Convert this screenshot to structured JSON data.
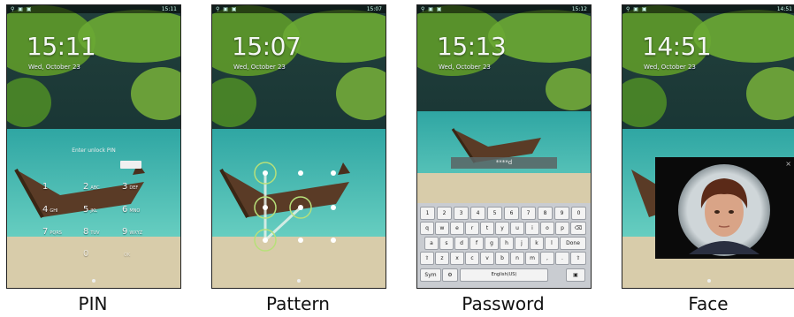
{
  "panels": [
    {
      "caption": "PIN",
      "time": "15:11",
      "date": "Wed, October 23"
    },
    {
      "caption": "Pattern",
      "time": "15:07",
      "date": "Wed, October 23"
    },
    {
      "caption": "Password",
      "time": "15:13",
      "date": "Wed, October 23"
    },
    {
      "caption": "Face",
      "time": "14:51",
      "date": "Wed, October 23"
    }
  ],
  "status": {
    "left": "⚲ ▣ ▣",
    "right1": "15:11",
    "right2": "15:07",
    "right3": "15:12",
    "right4": "14:51"
  },
  "pin": {
    "prompt": "Enter unlock PIN",
    "keys": [
      {
        "num": "1",
        "sub": ""
      },
      {
        "num": "2",
        "sub": "ABC"
      },
      {
        "num": "3",
        "sub": "DEF"
      },
      {
        "num": "4",
        "sub": "GHI"
      },
      {
        "num": "5",
        "sub": "JKL"
      },
      {
        "num": "6",
        "sub": "MNO"
      },
      {
        "num": "7",
        "sub": "PQRS"
      },
      {
        "num": "8",
        "sub": "TUV"
      },
      {
        "num": "9",
        "sub": "WXYZ"
      },
      {
        "num": "0",
        "sub": "OK"
      }
    ]
  },
  "password": {
    "field_value": "****d",
    "kb_row1": [
      "1",
      "2",
      "3",
      "4",
      "5",
      "6",
      "7",
      "8",
      "9",
      "0"
    ],
    "kb_row2": [
      "q",
      "w",
      "e",
      "r",
      "t",
      "y",
      "u",
      "i",
      "o",
      "p",
      "⌫"
    ],
    "kb_row3": [
      "a",
      "s",
      "d",
      "f",
      "g",
      "h",
      "j",
      "k",
      "l",
      "Done"
    ],
    "kb_row4": [
      "⇧",
      "z",
      "x",
      "c",
      "v",
      "b",
      "n",
      "m",
      ",",
      ".",
      "⇧"
    ],
    "sym": "Sym",
    "space": "English(US)"
  },
  "face": {
    "close": "×"
  }
}
